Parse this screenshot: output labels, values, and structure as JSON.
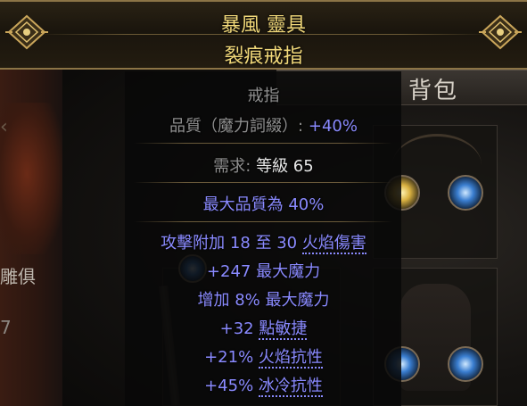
{
  "item": {
    "name": "暴風 靈具",
    "base_type": "裂痕戒指",
    "item_class": "戒指",
    "quality_label": "品質（魔力詞綴）:",
    "quality_value": "+40%",
    "requirements_label": "需求:",
    "requirements_value": "等級 65",
    "max_quality": "最大品質為 40%",
    "mods": [
      {
        "pre": "攻擊附加 18 至 30 ",
        "kw": "火焰傷害",
        "post": ""
      },
      {
        "pre": "+247 最大魔力",
        "kw": "",
        "post": ""
      },
      {
        "pre": "增加 8% 最大魔力",
        "kw": "",
        "post": ""
      },
      {
        "pre": "+32 ",
        "kw": "點敏捷",
        "post": ""
      },
      {
        "pre": "+21% ",
        "kw": "火焰抗性",
        "post": ""
      },
      {
        "pre": "+45% ",
        "kw": "冰冷抗性",
        "post": ""
      }
    ]
  },
  "background": {
    "stash_title": "背包",
    "left_label": "雕俱",
    "left_number": "7",
    "faded_label": "背包"
  },
  "colors": {
    "name": "#f2d97a",
    "mod": "#8a8aff",
    "property": "#c8c8c8"
  },
  "icons": [
    "ornament-corner-icon",
    "yellow-gem-icon",
    "blue-gem-icon",
    "arrow-left-icon"
  ]
}
